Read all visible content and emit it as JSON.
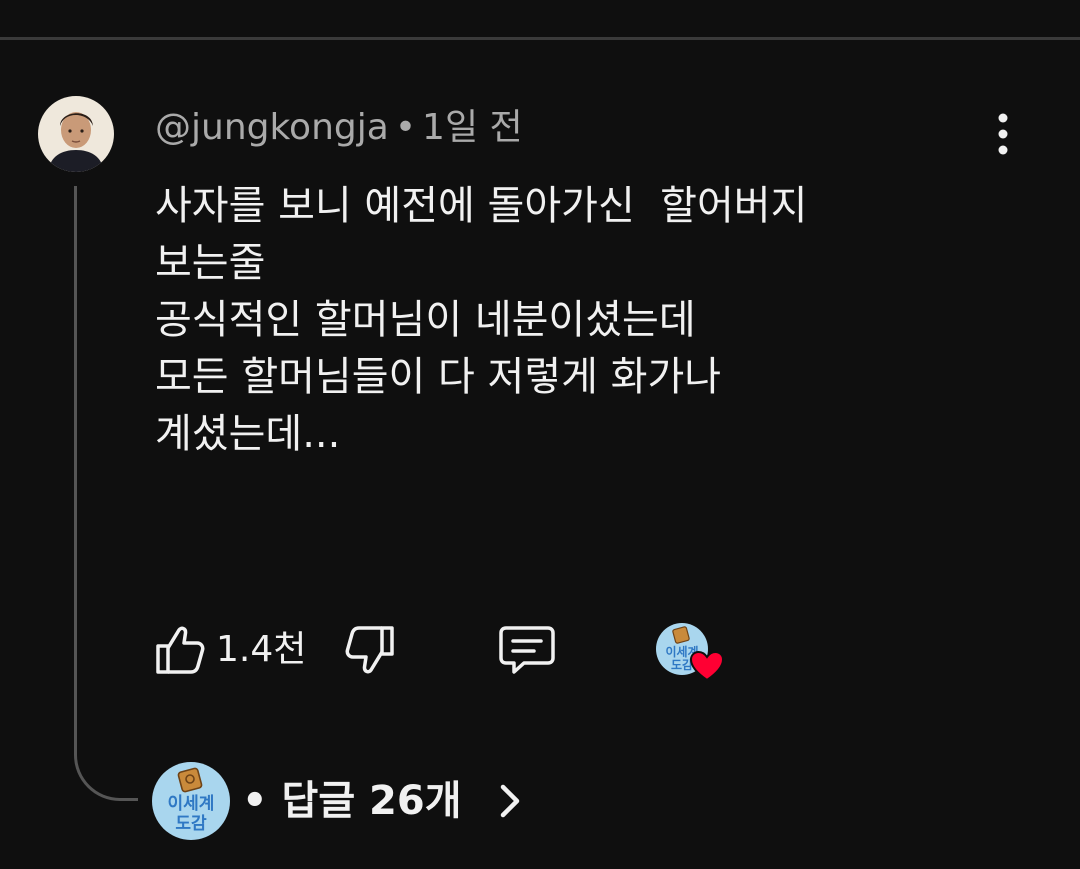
{
  "comment": {
    "author": "@jungkongja",
    "separator": "•",
    "time": "1일 전",
    "lines": [
      "사자를 보니 예전에 돌아가신  할어버지",
      "보는줄",
      "공식적인 할머님이 네분이셨는데",
      "모든 할머님들이 다 저렇게 화가나",
      "계셨는데..."
    ],
    "more_icon": "more-vertical-icon"
  },
  "actions": {
    "like_icon": "thumbs-up-icon",
    "like_count": "1.4천",
    "dislike_icon": "thumbs-down-icon",
    "reply_icon": "comment-icon",
    "creator_heart": {
      "channel_logo_text": "이세계 도감",
      "heart_color": "#ff0033"
    }
  },
  "replies": {
    "avatar_text": "이세계 도감",
    "separator": "•",
    "label": "답글 26개",
    "chevron_icon": "chevron-right-icon"
  },
  "colors": {
    "background": "#0f0f0f",
    "text_primary": "#f1f1f1",
    "text_secondary": "#aaaaaa",
    "thread_line": "#555555",
    "logo_bg": "#a9d6ee"
  }
}
